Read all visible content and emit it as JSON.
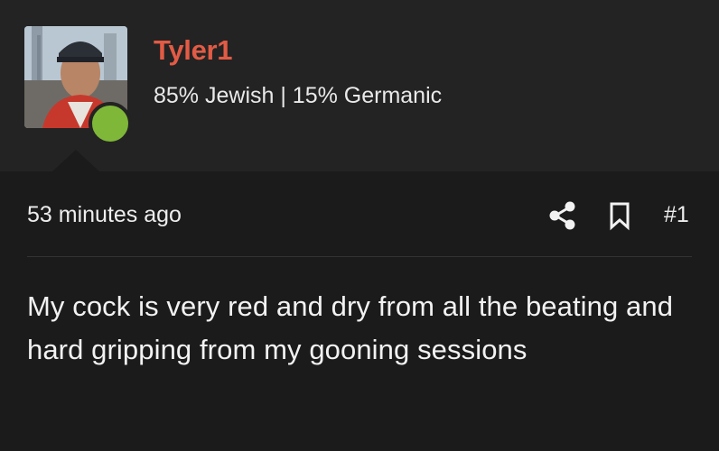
{
  "post": {
    "author": {
      "name": "Tyler1",
      "flair": "85% Jewish | 15% Germanic",
      "online_status_color": "#7fb738",
      "name_color": "#e25b45"
    },
    "timestamp": "53 minutes ago",
    "post_number": "#1",
    "body": "My cock is very red and dry from all the beating and hard gripping from my gooning sessions",
    "actions": {
      "share_icon": "share-icon",
      "bookmark_icon": "bookmark-icon"
    }
  }
}
